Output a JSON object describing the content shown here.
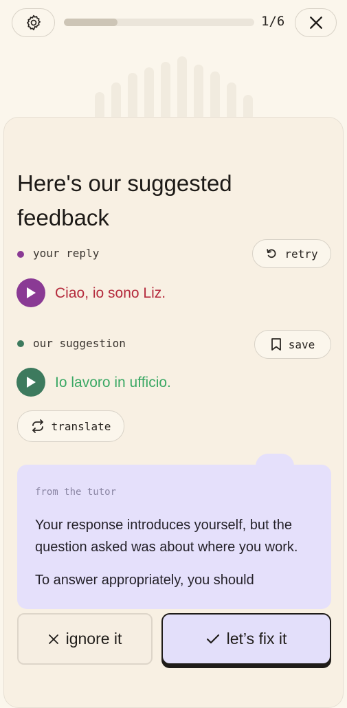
{
  "progress": {
    "text": "1/6",
    "fraction": 0.28
  },
  "title": "Here's our suggested feedback",
  "reply": {
    "label": "your reply",
    "retry_label": "retry",
    "text": "Ciao, io sono Liz.",
    "color": "#b42a3c",
    "dot_color": "#8a3a94"
  },
  "suggestion": {
    "label": "our suggestion",
    "save_label": "save",
    "text": "Io lavoro in ufficio.",
    "color": "#3aa864",
    "dot_color": "#3d7a5e"
  },
  "translate_label": "translate",
  "tutor": {
    "label": "from the tutor",
    "paragraph1": "Your response introduces yourself, but the question asked was about where you work.",
    "paragraph2": "To answer appropriately, you should"
  },
  "actions": {
    "ignore_label": "ignore it",
    "fix_label": "let’s fix it"
  },
  "colors": {
    "background": "#fbf6ec",
    "card": "#f8f0e3",
    "tutor_box": "#e5e0fb",
    "reply_play": "#8a3a94",
    "suggestion_play": "#3d7a5e"
  }
}
